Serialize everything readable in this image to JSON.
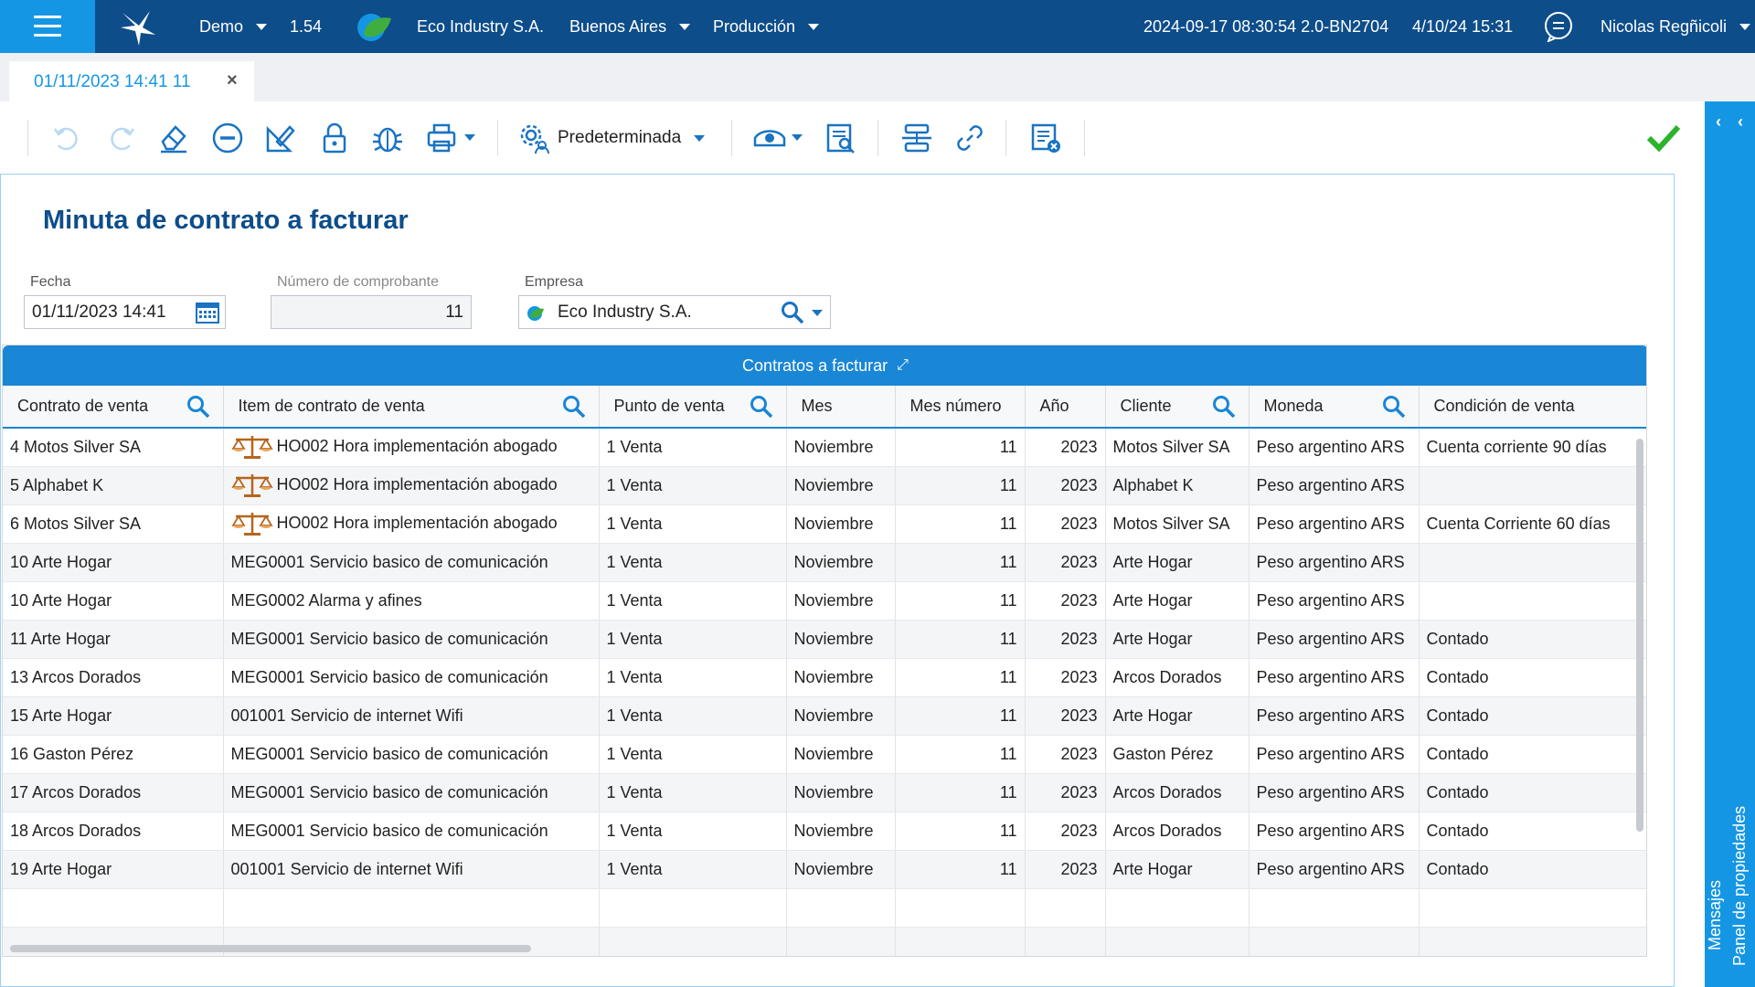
{
  "topbar": {
    "environment": "Demo",
    "version": "1.54",
    "company": "Eco Industry S.A.",
    "location": "Buenos Aires",
    "mode": "Producción",
    "build": "2024-09-17 08:30:54 2.0-BN2704",
    "datetime": "4/10/24 15:31",
    "user": "Nicolas Regñicoli"
  },
  "tab": {
    "label": "01/11/2023 14:41 11",
    "close": "×"
  },
  "toolbar": {
    "layout_label": "Predeterminada"
  },
  "sidepanel": {
    "messages": "Mensajes",
    "properties": "Panel de propiedades"
  },
  "form": {
    "title": "Minuta de contrato a facturar",
    "fecha_label": "Fecha",
    "fecha_value": "01/11/2023 14:41",
    "numero_label": "Número de comprobante",
    "numero_value": "11",
    "empresa_label": "Empresa",
    "empresa_value": "Eco Industry S.A."
  },
  "grid": {
    "title": "Contratos a facturar",
    "columns": [
      "Contrato de venta",
      "Item de contrato de venta",
      "Punto de venta",
      "Mes",
      "Mes número",
      "Año",
      "Cliente",
      "Moneda",
      "Condición de venta"
    ],
    "rows": [
      [
        "4 Motos Silver SA",
        "HO002 Hora implementación abogado",
        "1 Venta",
        "Noviembre",
        "11",
        "2023",
        "Motos Silver SA",
        "Peso argentino ARS",
        "Cuenta corriente 90 días"
      ],
      [
        "5 Alphabet K",
        "HO002 Hora implementación abogado",
        "1 Venta",
        "Noviembre",
        "11",
        "2023",
        "Alphabet K",
        "Peso argentino ARS",
        ""
      ],
      [
        "6 Motos Silver SA",
        "HO002 Hora implementación abogado",
        "1 Venta",
        "Noviembre",
        "11",
        "2023",
        "Motos Silver SA",
        "Peso argentino ARS",
        "Cuenta Corriente 60 días"
      ],
      [
        "10 Arte Hogar",
        "MEG0001 Servicio basico de comunicación",
        "1 Venta",
        "Noviembre",
        "11",
        "2023",
        "Arte Hogar",
        "Peso argentino ARS",
        ""
      ],
      [
        "10 Arte Hogar",
        "MEG0002 Alarma y afines",
        "1 Venta",
        "Noviembre",
        "11",
        "2023",
        "Arte Hogar",
        "Peso argentino ARS",
        ""
      ],
      [
        "11 Arte Hogar",
        "MEG0001 Servicio basico de comunicación",
        "1 Venta",
        "Noviembre",
        "11",
        "2023",
        "Arte Hogar",
        "Peso argentino ARS",
        "Contado"
      ],
      [
        "13 Arcos Dorados",
        "MEG0001 Servicio basico de comunicación",
        "1 Venta",
        "Noviembre",
        "11",
        "2023",
        "Arcos Dorados",
        "Peso argentino ARS",
        "Contado"
      ],
      [
        "15 Arte Hogar",
        "001001 Servicio de internet Wifi",
        "1 Venta",
        "Noviembre",
        "11",
        "2023",
        "Arte Hogar",
        "Peso argentino ARS",
        "Contado"
      ],
      [
        "16 Gaston Pérez",
        "MEG0001 Servicio basico de comunicación",
        "1 Venta",
        "Noviembre",
        "11",
        "2023",
        "Gaston Pérez",
        "Peso argentino ARS",
        "Contado"
      ],
      [
        "17 Arcos Dorados",
        "MEG0001 Servicio basico de comunicación",
        "1 Venta",
        "Noviembre",
        "11",
        "2023",
        "Arcos Dorados",
        "Peso argentino ARS",
        "Contado"
      ],
      [
        "18 Arcos Dorados",
        "MEG0001 Servicio basico de comunicación",
        "1 Venta",
        "Noviembre",
        "11",
        "2023",
        "Arcos Dorados",
        "Peso argentino ARS",
        "Contado"
      ],
      [
        "19 Arte Hogar",
        "001001 Servicio de internet Wifi",
        "1 Venta",
        "Noviembre",
        "11",
        "2023",
        "Arte Hogar",
        "Peso argentino ARS",
        "Contado"
      ]
    ],
    "icon_rows": [
      0,
      1,
      2
    ],
    "empty_rows": 2
  },
  "colors": {
    "topbar": "#0d4d8a",
    "accent": "#1596e4",
    "grid_header": "#1a86d6",
    "title": "#0d4d8a",
    "confirm": "#2bb32b"
  }
}
